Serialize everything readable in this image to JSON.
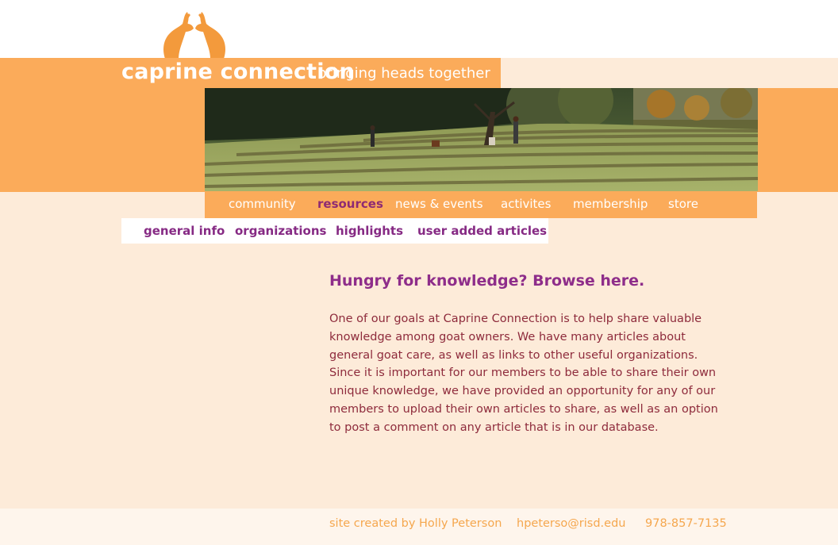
{
  "site": {
    "title": "caprine connection",
    "tagline": "bringing heads together",
    "logo_icon": "goat-heads-logo-icon"
  },
  "hero": {
    "image": "goats-in-hay-field-photo"
  },
  "main_nav": {
    "items": [
      {
        "label": "community",
        "active": false
      },
      {
        "label": "resources",
        "active": true
      },
      {
        "label": "news & events",
        "active": false
      },
      {
        "label": "activites",
        "active": false
      },
      {
        "label": "membership",
        "active": false
      },
      {
        "label": "store",
        "active": false
      }
    ]
  },
  "sub_nav": {
    "items": [
      {
        "label": "general info"
      },
      {
        "label": "organizations"
      },
      {
        "label": "highlights"
      },
      {
        "label": "user added articles"
      }
    ]
  },
  "content": {
    "heading": "Hungry for knowledge? Browse here.",
    "body": "One of our goals at Caprine Connection is to help share valuable knowledge among goat owners. We have many articles about general goat care, as well as links to other useful organizations. Since it is important for our members to be able to share their own unique knowledge, we have provided an opportunity for any of our members to upload their own articles to share, as well as an option to post a comment on any article that is in our database."
  },
  "footer": {
    "credit": "site created by Holly Peterson",
    "email": "hpeterso@risd.edu",
    "phone": "978-857-7135"
  },
  "colors": {
    "accent_orange": "#fbab5a",
    "page_background": "#fdebd9",
    "nav_active": "#8e2a73",
    "subnav_text": "#862a84",
    "body_text": "#8e2b3c"
  }
}
